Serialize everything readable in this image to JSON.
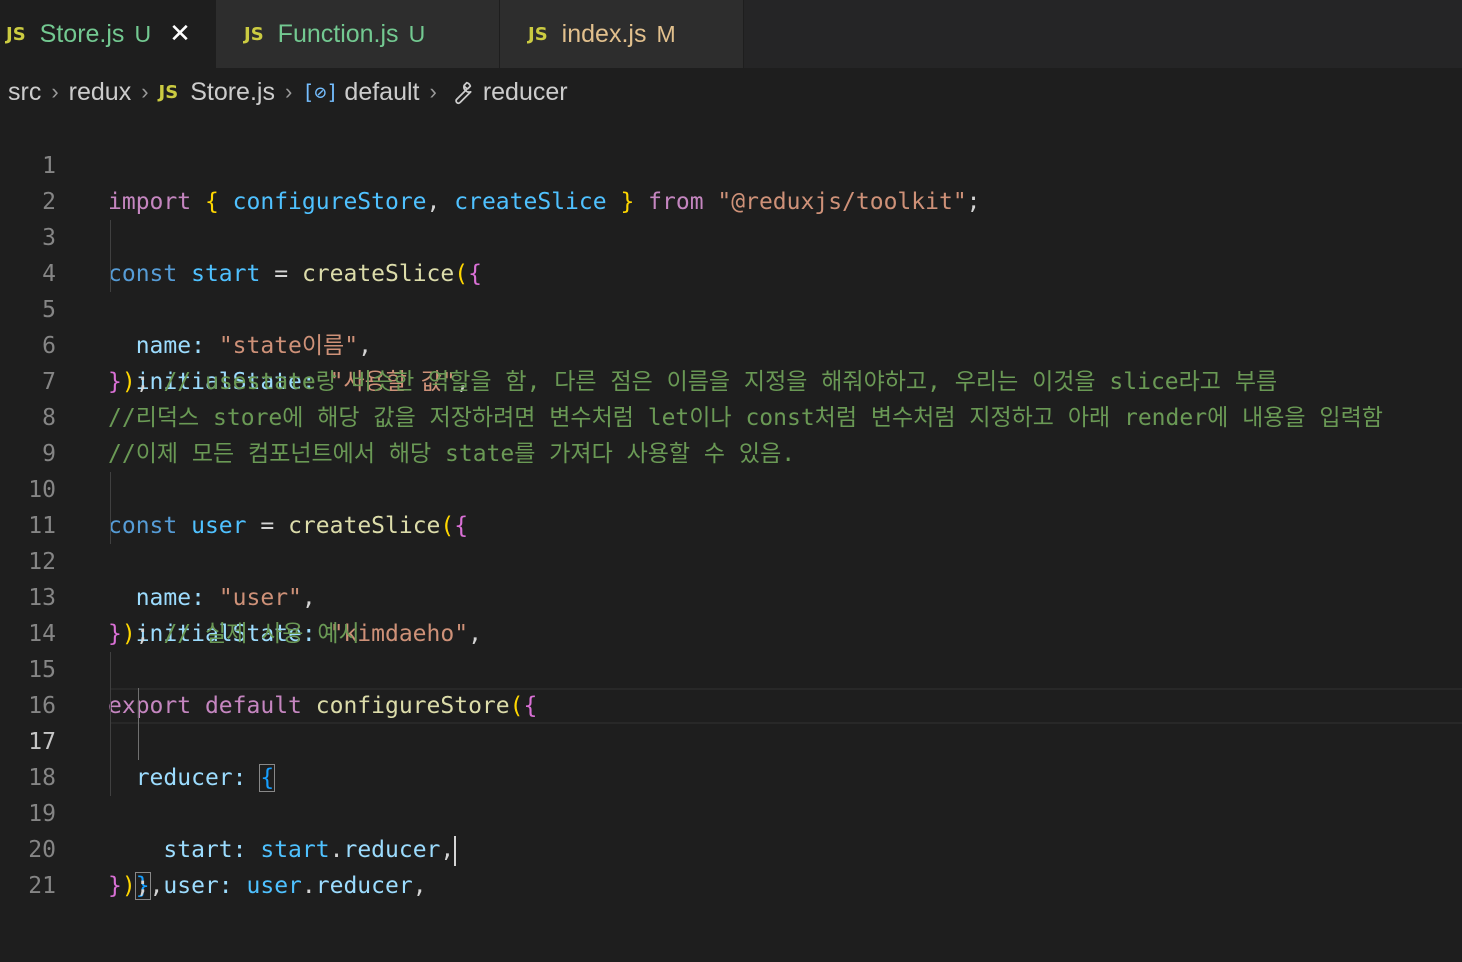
{
  "tabs": [
    {
      "lang": "JS",
      "name": "Store.js",
      "status": "U",
      "close": "✕"
    },
    {
      "lang": "JS",
      "name": "Function.js",
      "status": "U"
    },
    {
      "lang": "JS",
      "name": "index.js",
      "status": "M"
    }
  ],
  "breadcrumb": {
    "items": [
      "src",
      "redux",
      "Store.js",
      "default",
      "reducer"
    ],
    "lang": "JS",
    "symbol_icon": "[⊘]",
    "separator": "›"
  },
  "code": {
    "line_numbers": [
      "1",
      "2",
      "3",
      "4",
      "5",
      "6",
      "7",
      "8",
      "9",
      "10",
      "11",
      "12",
      "13",
      "14",
      "15",
      "16",
      "17",
      "18",
      "19",
      "20",
      "21"
    ],
    "current_line": 17,
    "l1": {
      "import": "import",
      "b_open": "{",
      "configureStore": "configureStore",
      "comma": ",",
      "createSlice": "createSlice",
      "b_close": "}",
      "from": "from",
      "module": "\"@reduxjs/toolkit\"",
      "semi": ";"
    },
    "l3": {
      "const": "const",
      "name": "start",
      "eq": "=",
      "fn": "createSlice",
      "p": "(",
      "b": "{"
    },
    "l4": {
      "key": "name",
      "colon": ":",
      "val": "\"state이름\"",
      "comma": ","
    },
    "l5": {
      "key": "initialState",
      "colon": ":",
      "val": "\"사용할 값\"",
      "comma": ","
    },
    "l6": {
      "b": "}",
      "p": ")",
      "semi": ";",
      "comment": "// usestate랑 비슷한 역할을 함, 다른 점은 이름을 지정을 해줘야하고, 우리는 이것을 slice라고 부름"
    },
    "l7": {
      "comment": "//리덕스 store에 해당 값을 저장하려면 변수처럼 let이나 const처럼 변수처럼 지정하고 아래 render에 내용을 입력함"
    },
    "l8": {
      "comment": "//이제 모든 컴포넌트에서 해당 state를 가져다 사용할 수 있음."
    },
    "l10": {
      "const": "const",
      "name": "user",
      "eq": "=",
      "fn": "createSlice",
      "p": "(",
      "b": "{"
    },
    "l11": {
      "key": "name",
      "colon": ":",
      "val": "\"user\"",
      "comma": ","
    },
    "l12": {
      "key": "initialState",
      "colon": ":",
      "val": "\"kimdaeho\"",
      "comma": ","
    },
    "l13": {
      "b": "}",
      "p": ")",
      "semi": ";",
      "comment": "// 실제 사용 예시"
    },
    "l15": {
      "export": "export",
      "default": "default",
      "fn": "configureStore",
      "p": "(",
      "b": "{"
    },
    "l16": {
      "key": "reducer",
      "colon": ":",
      "b": "{"
    },
    "l17": {
      "key": "start",
      "colon": ":",
      "obj": "start",
      "dot": ".",
      "prop": "reducer",
      "comma": ","
    },
    "l18": {
      "key": "user",
      "colon": ":",
      "obj": "user",
      "dot": ".",
      "prop": "reducer",
      "comma": ","
    },
    "l19": {
      "b": "}",
      "comma": ","
    },
    "l20": {
      "b": "}",
      "p": ")",
      "semi": ";"
    }
  },
  "colors": {
    "background": "#1e1e1e",
    "keyword": "#569cd6",
    "control_keyword": "#c586c0",
    "string": "#ce9178",
    "comment": "#6a9955",
    "function": "#dcdcaa",
    "property": "#9cdcfe"
  }
}
